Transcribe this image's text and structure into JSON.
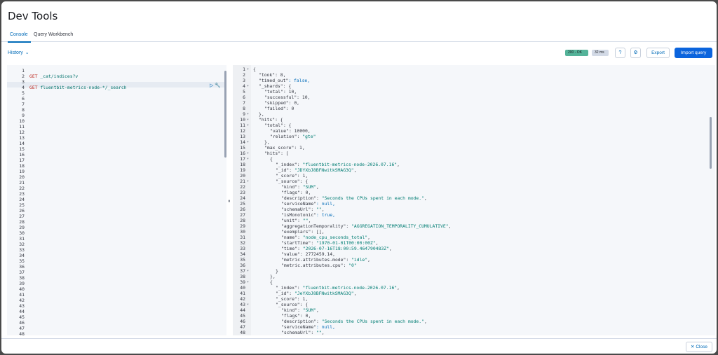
{
  "window": {
    "title": "Dev Tools"
  },
  "tabs": [
    {
      "label": "Console",
      "active": true
    },
    {
      "label": "Query Workbench",
      "active": false
    }
  ],
  "toolbar": {
    "history_label": "History",
    "status_badge": "200 - OK",
    "time_badge": "32 ms",
    "help_icon": "help-icon",
    "settings_icon": "settings-icon",
    "export_label": "Export",
    "import_label": "Import query"
  },
  "request_editor": {
    "line_count": 48,
    "lines": [
      {
        "n": 2,
        "method": "GET",
        "path": "_cat/indices?v"
      },
      {
        "n": 4,
        "method": "GET",
        "path": "fluentbit-metrics-node-*/_search"
      }
    ]
  },
  "response_editor": {
    "lines": [
      {
        "n": 1,
        "fold": true,
        "indent": 0,
        "text": "{"
      },
      {
        "n": 2,
        "indent": 1,
        "text": "\"took\": 8,"
      },
      {
        "n": 3,
        "indent": 1,
        "text": "\"timed_out\": false,"
      },
      {
        "n": 4,
        "fold": true,
        "indent": 1,
        "text": "\"_shards\": {"
      },
      {
        "n": 5,
        "indent": 2,
        "text": "\"total\": 10,"
      },
      {
        "n": 6,
        "indent": 2,
        "text": "\"successful\": 10,"
      },
      {
        "n": 7,
        "indent": 2,
        "text": "\"skipped\": 0,"
      },
      {
        "n": 8,
        "indent": 2,
        "text": "\"failed\": 0"
      },
      {
        "n": 9,
        "fold": true,
        "indent": 1,
        "text": "},"
      },
      {
        "n": 10,
        "fold": true,
        "indent": 1,
        "text": "\"hits\": {"
      },
      {
        "n": 11,
        "fold": true,
        "indent": 2,
        "text": "\"total\": {"
      },
      {
        "n": 12,
        "indent": 3,
        "text": "\"value\": 10000,"
      },
      {
        "n": 13,
        "indent": 3,
        "text": "\"relation\": \"gte\""
      },
      {
        "n": 14,
        "fold": true,
        "indent": 2,
        "text": "},"
      },
      {
        "n": 15,
        "indent": 2,
        "text": "\"max_score\": 1,"
      },
      {
        "n": 16,
        "fold": true,
        "indent": 2,
        "text": "\"hits\": ["
      },
      {
        "n": 17,
        "fold": true,
        "indent": 3,
        "text": "{"
      },
      {
        "n": 18,
        "indent": 4,
        "text": "\"_index\": \"fluentbit-metrics-node-2026.07.16\","
      },
      {
        "n": 19,
        "indent": 4,
        "text": "\"_id\": \"JDYXbJ8BFNwitkSMAG3Q\","
      },
      {
        "n": 20,
        "indent": 4,
        "text": "\"_score\": 1,"
      },
      {
        "n": 21,
        "fold": true,
        "indent": 4,
        "text": "\"_source\": {"
      },
      {
        "n": 22,
        "indent": 5,
        "text": "\"kind\": \"SUM\","
      },
      {
        "n": 23,
        "indent": 5,
        "text": "\"flags\": 0,"
      },
      {
        "n": 24,
        "indent": 5,
        "text": "\"description\": \"Seconds the CPUs spent in each mode.\","
      },
      {
        "n": 25,
        "indent": 5,
        "text": "\"serviceName\": null,"
      },
      {
        "n": 26,
        "indent": 5,
        "text": "\"schemaUrl\": \"\","
      },
      {
        "n": 27,
        "indent": 5,
        "text": "\"isMonotonic\": true,"
      },
      {
        "n": 28,
        "indent": 5,
        "text": "\"unit\": \"\","
      },
      {
        "n": 29,
        "indent": 5,
        "text": "\"aggregationTemporality\": \"AGGREGATION_TEMPORALITY_CUMULATIVE\","
      },
      {
        "n": 30,
        "indent": 5,
        "text": "\"exemplars\": [],"
      },
      {
        "n": 31,
        "indent": 5,
        "text": "\"name\": \"node_cpu_seconds_total\","
      },
      {
        "n": 32,
        "indent": 5,
        "text": "\"startTime\": \"1970-01-01T00:00:00Z\","
      },
      {
        "n": 33,
        "indent": 5,
        "text": "\"time\": \"2026-07-16T18:00:59.464790483Z\","
      },
      {
        "n": 34,
        "indent": 5,
        "text": "\"value\": 2772459.14,"
      },
      {
        "n": 35,
        "indent": 5,
        "text": "\"metric.attributes.mode\": \"idle\","
      },
      {
        "n": 36,
        "indent": 5,
        "text": "\"metric.attributes.cpu\": \"0\""
      },
      {
        "n": 37,
        "fold": true,
        "indent": 4,
        "text": "}"
      },
      {
        "n": 38,
        "indent": 3,
        "text": "},"
      },
      {
        "n": 39,
        "fold": true,
        "indent": 3,
        "text": "{"
      },
      {
        "n": 40,
        "indent": 4,
        "text": "\"_index\": \"fluentbit-metrics-node-2026.07.16\","
      },
      {
        "n": 41,
        "indent": 4,
        "text": "\"_id\": \"JeYXbJ8BFNwitkSMAG3Q\","
      },
      {
        "n": 42,
        "indent": 4,
        "text": "\"_score\": 1,"
      },
      {
        "n": 43,
        "fold": true,
        "indent": 4,
        "text": "\"_source\": {"
      },
      {
        "n": 44,
        "indent": 5,
        "text": "\"kind\": \"SUM\","
      },
      {
        "n": 45,
        "indent": 5,
        "text": "\"flags\": 0,"
      },
      {
        "n": 46,
        "indent": 5,
        "text": "\"description\": \"Seconds the CPUs spent in each mode.\","
      },
      {
        "n": 47,
        "indent": 5,
        "text": "\"serviceName\": null,"
      },
      {
        "n": 48,
        "indent": 5,
        "text": "\"schemaUrl\": \"\","
      }
    ]
  },
  "footer": {
    "close_label": "Close"
  }
}
